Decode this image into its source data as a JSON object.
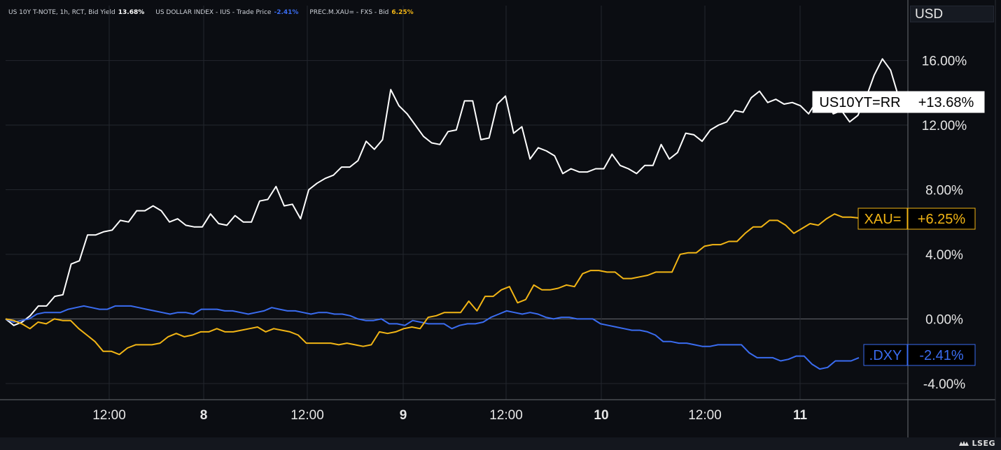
{
  "legend": [
    {
      "label": "US 10Y T-NOTE, 1h, RCT, Bid Yield",
      "value": "13.68%",
      "color": "#ffffff"
    },
    {
      "label": "US DOLLAR INDEX - IUS - Trade Price",
      "value": "-2.41%",
      "color": "#3a6cf0"
    },
    {
      "label": "PREC.M.XAU= - FXS - Bid",
      "value": "6.25%",
      "color": "#f2b515"
    }
  ],
  "currency": "USD",
  "brand": "LSEG",
  "colors": {
    "background": "#0b0d12",
    "grid": "#23262d",
    "white_series": "#ffffff",
    "blue_series": "#3a6cf0",
    "gold_series": "#f2b515"
  },
  "chart_data": {
    "type": "line",
    "x_tick_labels": [
      "12:00",
      "8",
      "12:00",
      "9",
      "12:00",
      "10",
      "12:00",
      "11"
    ],
    "y_ticks": [
      "16.00%",
      "12.00%",
      "8.00%",
      "4.00%",
      "0.00%",
      "-4.00%"
    ],
    "ylim": [
      -5.0,
      19.4
    ],
    "grid": true,
    "series": [
      {
        "name": "US10YT=RR",
        "end_label": "+13.68%",
        "color": "#ffffff",
        "values": [
          0.0,
          -0.4,
          -0.2,
          0.2,
          0.8,
          0.8,
          1.4,
          1.5,
          3.4,
          3.6,
          5.2,
          5.2,
          5.4,
          5.5,
          6.1,
          6.0,
          6.7,
          6.7,
          7.0,
          6.7,
          6.0,
          6.2,
          5.8,
          5.7,
          5.7,
          6.5,
          5.9,
          5.8,
          6.4,
          6.0,
          6.0,
          7.3,
          7.4,
          8.2,
          7.0,
          7.1,
          6.2,
          8.0,
          8.4,
          8.7,
          8.9,
          9.4,
          9.4,
          9.8,
          11.0,
          10.5,
          11.1,
          14.2,
          13.2,
          12.7,
          12.0,
          11.3,
          10.9,
          10.8,
          11.6,
          11.7,
          13.5,
          13.5,
          11.1,
          11.2,
          13.3,
          13.8,
          11.5,
          11.9,
          9.9,
          10.6,
          10.4,
          10.1,
          9.0,
          9.3,
          9.1,
          9.1,
          9.3,
          9.3,
          10.2,
          9.5,
          9.3,
          9.0,
          9.5,
          9.5,
          10.8,
          9.9,
          10.3,
          11.5,
          11.4,
          11.0,
          11.7,
          12.0,
          12.2,
          12.9,
          12.8,
          13.7,
          14.1,
          13.4,
          13.6,
          13.3,
          13.4,
          13.2,
          12.7,
          13.5,
          14.0,
          12.7,
          12.9,
          12.2,
          12.6,
          13.7,
          15.1,
          16.1,
          15.4,
          13.7
        ]
      },
      {
        "name": ".DXY",
        "end_label": "-2.41%",
        "color": "#3a6cf0",
        "values": [
          0.0,
          -0.2,
          -0.1,
          0.0,
          0.3,
          0.4,
          0.4,
          0.4,
          0.6,
          0.7,
          0.8,
          0.7,
          0.6,
          0.6,
          0.8,
          0.8,
          0.8,
          0.7,
          0.6,
          0.5,
          0.4,
          0.3,
          0.4,
          0.4,
          0.3,
          0.6,
          0.6,
          0.6,
          0.5,
          0.5,
          0.4,
          0.3,
          0.4,
          0.5,
          0.7,
          0.6,
          0.5,
          0.5,
          0.4,
          0.3,
          0.4,
          0.4,
          0.3,
          0.3,
          0.2,
          0.0,
          -0.1,
          -0.1,
          0.0,
          -0.3,
          -0.3,
          -0.4,
          -0.1,
          -0.2,
          -0.3,
          -0.3,
          -0.3,
          -0.6,
          -0.4,
          -0.3,
          -0.3,
          -0.2,
          0.1,
          0.3,
          0.5,
          0.4,
          0.3,
          0.4,
          0.3,
          0.1,
          0.0,
          0.1,
          0.1,
          0.0,
          0.0,
          0.0,
          -0.3,
          -0.4,
          -0.5,
          -0.6,
          -0.7,
          -0.7,
          -0.8,
          -1.0,
          -1.4,
          -1.4,
          -1.5,
          -1.5,
          -1.6,
          -1.7,
          -1.7,
          -1.6,
          -1.6,
          -1.6,
          -1.6,
          -2.1,
          -2.4,
          -2.4,
          -2.4,
          -2.6,
          -2.5,
          -2.3,
          -2.3,
          -2.8,
          -3.1,
          -3.0,
          -2.6,
          -2.6,
          -2.6,
          -2.4
        ]
      },
      {
        "name": "XAU=",
        "end_label": "+6.25%",
        "color": "#f2b515",
        "values": [
          0.0,
          -0.1,
          -0.3,
          -0.6,
          -0.2,
          -0.3,
          0.0,
          -0.1,
          -0.1,
          -0.6,
          -1.0,
          -1.4,
          -2.0,
          -2.0,
          -2.2,
          -1.8,
          -1.6,
          -1.6,
          -1.6,
          -1.5,
          -1.1,
          -0.9,
          -1.1,
          -1.0,
          -0.8,
          -0.8,
          -0.6,
          -0.8,
          -0.8,
          -0.7,
          -0.6,
          -0.5,
          -0.8,
          -0.6,
          -0.7,
          -0.8,
          -1.0,
          -1.5,
          -1.5,
          -1.5,
          -1.5,
          -1.6,
          -1.5,
          -1.6,
          -1.7,
          -1.6,
          -0.8,
          -0.9,
          -0.8,
          -0.6,
          -0.5,
          -0.6,
          0.1,
          0.2,
          0.4,
          0.4,
          0.4,
          1.1,
          0.5,
          1.4,
          1.4,
          1.8,
          2.0,
          1.0,
          1.2,
          2.1,
          1.8,
          1.8,
          1.9,
          2.1,
          2.0,
          2.8,
          3.0,
          3.0,
          2.9,
          2.9,
          2.5,
          2.5,
          2.6,
          2.7,
          2.9,
          2.9,
          2.9,
          4.0,
          4.1,
          4.1,
          4.5,
          4.6,
          4.6,
          4.8,
          4.8,
          5.3,
          5.7,
          5.7,
          6.1,
          6.1,
          5.8,
          5.3,
          5.6,
          5.9,
          5.8,
          6.2,
          6.5,
          6.3,
          6.3,
          6.25
        ]
      }
    ]
  }
}
